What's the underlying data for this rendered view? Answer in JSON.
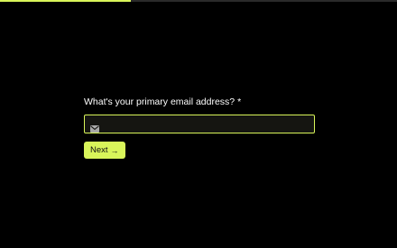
{
  "progress": {
    "fraction": 0.33,
    "color": "#d9f55a"
  },
  "question": {
    "label": "What's your primary email address?",
    "required_mark": "*"
  },
  "email": {
    "value": "",
    "placeholder": "",
    "icon": "mail-icon"
  },
  "actions": {
    "next_label": "Next",
    "next_arrow": "→"
  },
  "colors": {
    "accent": "#d9f55a",
    "background": "#000000",
    "input_background": "#151511"
  }
}
